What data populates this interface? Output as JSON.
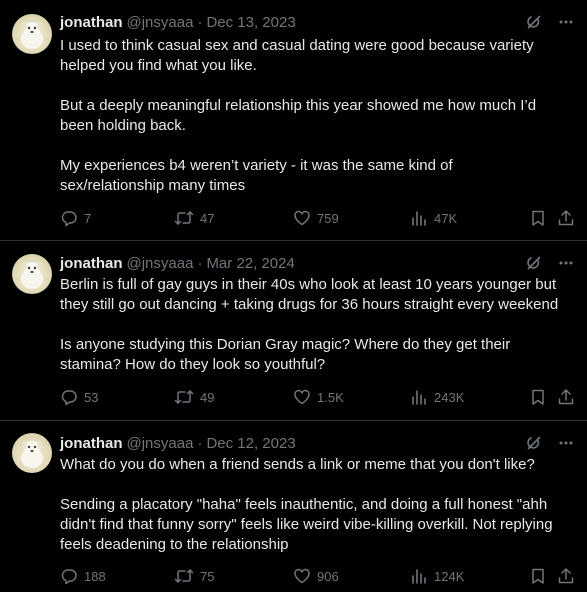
{
  "tweets": [
    {
      "name": "jonathan",
      "handle": "@jnsyaaa",
      "separator": "·",
      "date": "Dec 13, 2023",
      "text": "I used to think casual sex and casual dating were good because variety\nhelped you find what you like.\n\nBut a deeply meaningful relationship this year showed me how much I’d\nbeen holding back.\n\nMy experiences b4 weren’t variety - it was the same kind of\nsex/relationship many times",
      "replies": "7",
      "reposts": "47",
      "likes": "759",
      "views": "47K"
    },
    {
      "name": "jonathan",
      "handle": "@jnsyaaa",
      "separator": "·",
      "date": "Mar 22, 2024",
      "text": "Berlin is full of gay guys in their 40s who look at least 10 years younger but\nthey still go out dancing + taking drugs for 36 hours straight every weekend\n\nIs anyone studying this Dorian Gray magic? Where do they get their\nstamina? How do they look so youthful?",
      "replies": "53",
      "reposts": "49",
      "likes": "1.5K",
      "views": "243K"
    },
    {
      "name": "jonathan",
      "handle": "@jnsyaaa",
      "separator": "·",
      "date": "Dec 12, 2023",
      "text": "What do you do when a friend sends a link or meme that you don't like?\n\nSending a placatory \"haha\" feels inauthentic, and doing a full honest \"ahh\ndidn't find that funny sorry\" feels like weird vibe-killing overkill. Not replying\nfeels deadening to the relationship",
      "replies": "188",
      "reposts": "75",
      "likes": "906",
      "views": "124K"
    }
  ],
  "icons": {
    "grok": "grok-icon",
    "more": "more-icon",
    "reply": "reply-icon",
    "repost": "repost-icon",
    "like": "heart-icon",
    "views": "views-icon",
    "bookmark": "bookmark-icon",
    "share": "share-icon"
  },
  "colors": {
    "background": "#000000",
    "text": "#e7e9ea",
    "muted": "#71767b",
    "divider": "#2f3336"
  }
}
